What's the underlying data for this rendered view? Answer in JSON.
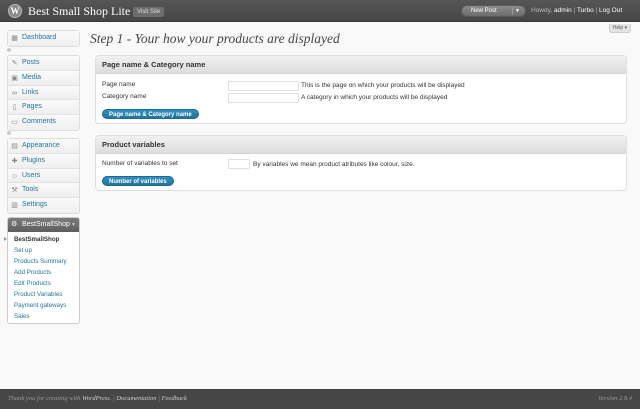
{
  "header": {
    "logo_glyph": "W",
    "site_title": "Best Small Shop Lite",
    "visit_site": "Visit Site",
    "new_post": "New Post",
    "howdy": "Howdy,",
    "username": "admin",
    "sep1": "|",
    "turbo": "Turbo",
    "sep2": "|",
    "logout": "Log Out"
  },
  "help_tab": "Help ▾",
  "sidebar": {
    "dashboard": {
      "label": "Dashboard",
      "icon": "dashboard-icon"
    },
    "content_items": [
      {
        "label": "Posts",
        "icon": "pin-icon"
      },
      {
        "label": "Media",
        "icon": "media-icon"
      },
      {
        "label": "Links",
        "icon": "link-icon"
      },
      {
        "label": "Pages",
        "icon": "page-icon"
      },
      {
        "label": "Comments",
        "icon": "comment-icon"
      }
    ],
    "admin_items": [
      {
        "label": "Appearance",
        "icon": "appearance-icon"
      },
      {
        "label": "Plugins",
        "icon": "plugin-icon"
      },
      {
        "label": "Users",
        "icon": "users-icon"
      },
      {
        "label": "Tools",
        "icon": "tools-icon"
      },
      {
        "label": "Settings",
        "icon": "settings-icon"
      }
    ],
    "plugin_menu": {
      "title": "BestSmallShop",
      "items": [
        {
          "label": "BestSmallShop",
          "current": true
        },
        {
          "label": "Set up"
        },
        {
          "label": "Products Summary"
        },
        {
          "label": "Add Products"
        },
        {
          "label": "Edit Products"
        },
        {
          "label": "Product Variables"
        },
        {
          "label": "Payment gateways"
        },
        {
          "label": "Sales"
        }
      ]
    }
  },
  "main": {
    "title": "Step 1 - Your how your products are displayed",
    "box1": {
      "heading": "Page name & Category name",
      "page_name_label": "Page name",
      "page_name_value": "",
      "page_name_desc": "This is the page on which your products will be displayed",
      "category_label": "Category name",
      "category_value": "",
      "category_desc": "A category in which your products will be displayed",
      "button": "Page name & Category name"
    },
    "box2": {
      "heading": "Product variables",
      "count_label": "Number of variables to set",
      "count_value": "",
      "count_desc": "By variables we mean product atributes like colour, size.",
      "button": "Number of variables"
    }
  },
  "footer": {
    "thanks": "Thank you for creating with",
    "wordpress": "WordPress",
    "sep_a": ". |",
    "documentation": "Documentation",
    "sep_b": "|",
    "feedback": "Feedback",
    "version": "Version 2.8.4"
  },
  "colors": {
    "link": "#21759b",
    "header_bg": "#464646",
    "button_primary": "#21759b"
  }
}
